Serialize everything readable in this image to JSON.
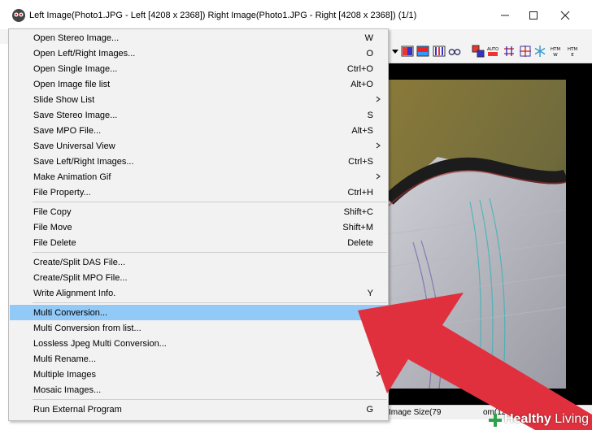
{
  "window": {
    "title": "Left Image(Photo1.JPG - Left [4208 x 2368]) Right Image(Photo1.JPG - Right [4208 x 2368])  (1/1)"
  },
  "menu": {
    "items": [
      {
        "label": "Open Stereo Image...",
        "shortcut": "W",
        "submenu": false
      },
      {
        "label": "Open Left/Right Images...",
        "shortcut": "O",
        "submenu": false
      },
      {
        "label": "Open Single Image...",
        "shortcut": "Ctrl+O",
        "submenu": false
      },
      {
        "label": "Open Image file list",
        "shortcut": "Alt+O",
        "submenu": false
      },
      {
        "label": "Slide Show List",
        "shortcut": "",
        "submenu": true
      },
      {
        "label": "Save Stereo Image...",
        "shortcut": "S",
        "submenu": false
      },
      {
        "label": "Save MPO File...",
        "shortcut": "Alt+S",
        "submenu": false
      },
      {
        "label": "Save Universal View",
        "shortcut": "",
        "submenu": true
      },
      {
        "label": "Save Left/Right Images...",
        "shortcut": "Ctrl+S",
        "submenu": false
      },
      {
        "label": "Make Animation Gif",
        "shortcut": "",
        "submenu": true
      },
      {
        "label": "File  Property...",
        "shortcut": "Ctrl+H",
        "submenu": false
      },
      {
        "label": "File Copy",
        "shortcut": "Shift+C",
        "submenu": false
      },
      {
        "label": "File Move",
        "shortcut": "Shift+M",
        "submenu": false
      },
      {
        "label": "File Delete",
        "shortcut": "Delete",
        "submenu": false
      },
      {
        "label": "Create/Split DAS File...",
        "shortcut": "",
        "submenu": false
      },
      {
        "label": "Create/Split MPO File...",
        "shortcut": "",
        "submenu": false
      },
      {
        "label": "Write Alignment Info.",
        "shortcut": "Y",
        "submenu": false
      },
      {
        "label": "Multi Conversion...",
        "shortcut": "",
        "submenu": false
      },
      {
        "label": "Multi Conversion from list...",
        "shortcut": "",
        "submenu": false
      },
      {
        "label": "Lossless Jpeg Multi Conversion...",
        "shortcut": "",
        "submenu": false
      },
      {
        "label": "Multi Rename...",
        "shortcut": "",
        "submenu": false
      },
      {
        "label": "Multiple Images",
        "shortcut": "",
        "submenu": true
      },
      {
        "label": "Mosaic Images...",
        "shortcut": "",
        "submenu": false
      },
      {
        "label": "Run External Program",
        "shortcut": "G",
        "submenu": false
      }
    ],
    "highlighted_index": 17,
    "highlight_color": "#91c9f7"
  },
  "toolbar": {
    "buttons": [
      {
        "icon": "dropdown-arrow-icon"
      },
      {
        "icon": "stereo-red-blue-icon"
      },
      {
        "icon": "red-cyan-anaglyph-icon"
      },
      {
        "icon": "interlaced-icon"
      },
      {
        "icon": "glasses-icon"
      },
      {
        "icon": "swap-icon"
      },
      {
        "icon": "auto-align-icon",
        "label": "AUTO"
      },
      {
        "icon": "grid-icon"
      },
      {
        "icon": "crosshair-icon"
      },
      {
        "icon": "snowflake-icon"
      },
      {
        "icon": "html-export-icon",
        "label": "HTM W"
      },
      {
        "icon": "html-export-e-icon",
        "label": "HTM E"
      }
    ]
  },
  "status": {
    "image_size": "Image Size(79",
    "zoom": "om(12.%)"
  },
  "watermark": {
    "text_bold": "Healthy",
    "text_light": "Living"
  },
  "colors": {
    "arrow_red": "#e0303e",
    "menu_bg": "#f2f2f2"
  }
}
